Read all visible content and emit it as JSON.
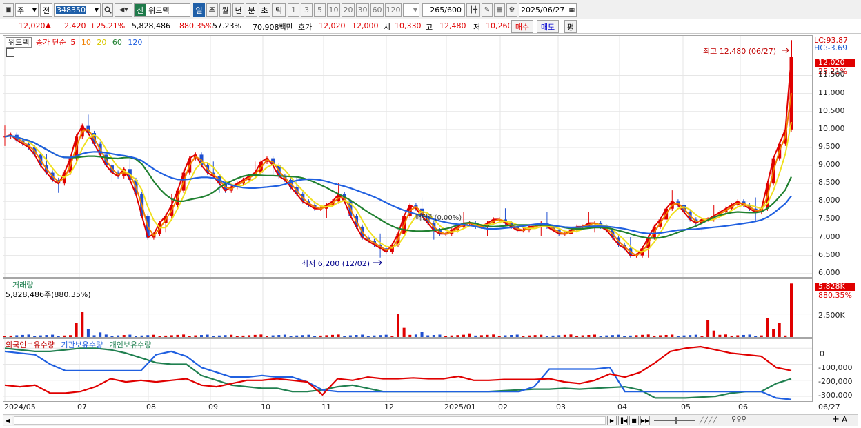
{
  "toolbar": {
    "market": "주",
    "type": "전",
    "code": "348350",
    "badge": "신",
    "name": "위드텍",
    "periods": [
      "일",
      "주",
      "월",
      "년",
      "분",
      "초",
      "틱"
    ],
    "active_period": "일",
    "intervals": [
      "1",
      "3",
      "5",
      "10",
      "20",
      "30",
      "60",
      "120"
    ],
    "count_value": "265",
    "count_total": "/600",
    "date": "2025/06/27"
  },
  "quote": {
    "price": "12,020",
    "change": "2,420",
    "change_pct": "+25.21%",
    "volume": "5,828,486",
    "vol_ratio": "880.35%",
    "turnover_pct": "57.23%",
    "amount": "70,908백만",
    "bid_label": "호가",
    "bid": "12,020",
    "ask": "12,000",
    "open_label": "시",
    "open": "10,330",
    "high_label": "고",
    "high": "12,480",
    "low_label": "저",
    "low": "10,260",
    "buy_button": "매수",
    "sell_button": "매도",
    "eval_button": "평"
  },
  "price_panel": {
    "tag": "위드텍",
    "legend_title": "종가 단순",
    "ma_periods": [
      "5",
      "10",
      "20",
      "60",
      "120"
    ],
    "ma_colors": [
      "#e00000",
      "#f08000",
      "#f0e020",
      "#208030",
      "#2060e0"
    ],
    "lc": "LC:93.87",
    "hc": "HC:-3.69",
    "high_annotation": "최고 12,480 (06/27)",
    "low_annotation": "최저 6,200 (12/02)",
    "mid_annotation": "배당락(0.00%)",
    "current_price": "12,020",
    "current_pct": "25.21%",
    "y_labels": [
      "11,500",
      "11,000",
      "10,500",
      "10,000",
      "9,500",
      "9,000",
      "8,500",
      "8,000",
      "7,500",
      "7,000",
      "6,500",
      "6,000"
    ]
  },
  "volume_panel": {
    "title": "거래량",
    "subtitle": "5,828,486주(880.35%)",
    "current": "5,828K",
    "current_pct": "880.35%",
    "y_labels": [
      "2,500K"
    ]
  },
  "holdings_panel": {
    "legend": [
      "외국인보유수량",
      "기관보유수량",
      "개인보유수량"
    ],
    "colors": [
      "#e00000",
      "#2060e0",
      "#208050"
    ],
    "y_labels": [
      "0",
      "-100,000",
      "-200,000",
      "-300,000"
    ]
  },
  "x_axis": {
    "labels": [
      "2024/05",
      "07",
      "08",
      "09",
      "10",
      "11",
      "12",
      "2025/01",
      "02",
      "03",
      "04",
      "05",
      "06"
    ],
    "last_label": "06/27"
  },
  "chart_data": {
    "type": "line",
    "title": "위드텍 종가 단순 5 10 20 60 120",
    "price_range": [
      5900,
      12600
    ],
    "price_close_series": [
      9800,
      9850,
      9700,
      9600,
      9500,
      9300,
      9000,
      8800,
      8600,
      8500,
      8800,
      9200,
      9800,
      10100,
      9900,
      9600,
      9300,
      9000,
      8800,
      8700,
      8900,
      8600,
      8200,
      7600,
      7000,
      7100,
      7400,
      7600,
      7900,
      8300,
      8800,
      9200,
      9300,
      9000,
      8800,
      8700,
      8500,
      8300,
      8400,
      8500,
      8600,
      8700,
      8800,
      9100,
      9200,
      9000,
      8700,
      8600,
      8400,
      8200,
      8000,
      7900,
      7800,
      7800,
      7900,
      8000,
      8200,
      8000,
      7600,
      7300,
      7000,
      6900,
      6800,
      6700,
      6600,
      6800,
      7100,
      7600,
      7900,
      7800,
      7600,
      7400,
      7200,
      7100,
      7100,
      7200,
      7300,
      7400,
      7400,
      7300,
      7300,
      7400,
      7500,
      7500,
      7400,
      7300,
      7200,
      7200,
      7300,
      7300,
      7400,
      7300,
      7200,
      7100,
      7100,
      7200,
      7300,
      7300,
      7400,
      7400,
      7300,
      7200,
      7000,
      6800,
      6700,
      6500,
      6500,
      6700,
      7000,
      7300,
      7500,
      7800,
      8000,
      7900,
      7700,
      7500,
      7400,
      7500,
      7500,
      7600,
      7700,
      7800,
      7900,
      8000,
      7900,
      7800,
      7700,
      7800,
      8500,
      9200,
      9600,
      10000,
      12020
    ],
    "ma_series": [
      "MA5",
      "MA10",
      "MA20",
      "MA60",
      "MA120"
    ],
    "annotations": {
      "high": 12480,
      "high_date": "06/27",
      "low": 6200,
      "low_date": "12/02"
    },
    "volume_k": {
      "max_label": "5,828K",
      "peak_2024_07": 2700,
      "peak_12": 2500,
      "latest": 5828
    },
    "holdings_range": [
      -330000,
      40000
    ],
    "foreign": [
      -230000,
      -240000,
      -230000,
      -280000,
      -280000,
      -270000,
      -240000,
      -190000,
      -210000,
      -200000,
      -210000,
      -200000,
      -190000,
      -230000,
      -240000,
      -220000,
      -200000,
      -200000,
      -190000,
      -200000,
      -210000,
      -290000,
      -190000,
      -200000,
      -180000,
      -190000,
      -190000,
      -185000,
      -190000,
      -190000,
      -175000,
      -200000,
      -200000,
      -195000,
      -195000,
      -195000,
      -190000,
      -210000,
      -220000,
      -200000,
      -160000,
      -180000,
      -150000,
      -90000,
      -20000,
      0,
      10000,
      -10000,
      -30000,
      -40000,
      -50000,
      -120000,
      -140000
    ],
    "institution": [
      -20000,
      -30000,
      -40000,
      -100000,
      -140000,
      -140000,
      -140000,
      -140000,
      -140000,
      -140000,
      -40000,
      -20000,
      -50000,
      -120000,
      -150000,
      -180000,
      -180000,
      -170000,
      -180000,
      -180000,
      -210000,
      -260000,
      -270000,
      -270000,
      -270000,
      -270000,
      -270000,
      -270000,
      -270000,
      -270000,
      -270000,
      -270000,
      -270000,
      -270000,
      -270000,
      -240000,
      -130000,
      -130000,
      -130000,
      -130000,
      -120000,
      -270000,
      -270000,
      -270000,
      -270000,
      -270000,
      -270000,
      -270000,
      -270000,
      -270000,
      -270000,
      -310000,
      -320000
    ],
    "individual": [
      0,
      -10000,
      -20000,
      -20000,
      -10000,
      0,
      0,
      -10000,
      -30000,
      -60000,
      -90000,
      -100000,
      -100000,
      -170000,
      -200000,
      -230000,
      -240000,
      -250000,
      -250000,
      -270000,
      -270000,
      -260000,
      -240000,
      -230000,
      -250000,
      -270000,
      -270000,
      -270000,
      -270000,
      -270000,
      -270000,
      -270000,
      -270000,
      -265000,
      -260000,
      -255000,
      -255000,
      -250000,
      -255000,
      -250000,
      -245000,
      -240000,
      -260000,
      -310000,
      -310000,
      -310000,
      -305000,
      -300000,
      -280000,
      -270000,
      -270000,
      -220000,
      -190000
    ]
  },
  "icons": [
    "layout-icon",
    "search-icon",
    "speaker-icon",
    "candle-icon",
    "tools-icon",
    "save-icon",
    "gear-icon",
    "calendar-icon"
  ]
}
